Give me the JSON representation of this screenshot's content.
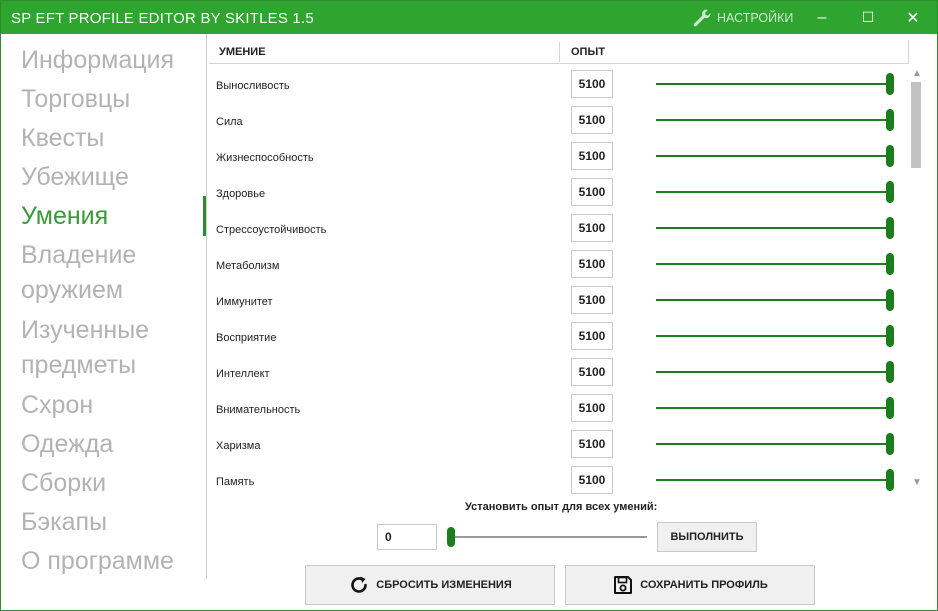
{
  "window": {
    "title": "SP EFT PROFILE EDITOR BY SKITLES 1.5",
    "settings_label": "НАСТРОЙКИ",
    "settings_icon": "wrench-icon",
    "minimize": "–",
    "maximize": "☐",
    "close": "✕"
  },
  "sidebar": {
    "items": [
      {
        "label": "Информация",
        "active": false
      },
      {
        "label": "Торговцы",
        "active": false
      },
      {
        "label": "Квесты",
        "active": false
      },
      {
        "label": "Убежище",
        "active": false
      },
      {
        "label": "Умения",
        "active": true
      },
      {
        "label": "Владение",
        "active": false
      },
      {
        "label": "оружием",
        "active": false
      },
      {
        "label": "Изученные",
        "active": false
      },
      {
        "label": "предметы",
        "active": false
      },
      {
        "label": "Схрон",
        "active": false
      },
      {
        "label": "Одежда",
        "active": false
      },
      {
        "label": "Сборки",
        "active": false
      },
      {
        "label": "Бэкапы",
        "active": false
      },
      {
        "label": "О программе",
        "active": false
      }
    ]
  },
  "table": {
    "columns": [
      "УМЕНИЕ",
      "ОПЫТ"
    ],
    "rows": [
      {
        "skill": "Выносливость",
        "xp": "5100",
        "level": 1.0
      },
      {
        "skill": "Сила",
        "xp": "5100",
        "level": 1.0
      },
      {
        "skill": "Жизнеспособность",
        "xp": "5100",
        "level": 1.0
      },
      {
        "skill": "Здоровье",
        "xp": "5100",
        "level": 1.0
      },
      {
        "skill": "Стрессоустойчивость",
        "xp": "5100",
        "level": 1.0
      },
      {
        "skill": "Метаболизм",
        "xp": "5100",
        "level": 1.0
      },
      {
        "skill": "Иммунитет",
        "xp": "5100",
        "level": 1.0
      },
      {
        "skill": "Восприятие",
        "xp": "5100",
        "level": 1.0
      },
      {
        "skill": "Интеллект",
        "xp": "5100",
        "level": 1.0
      },
      {
        "skill": "Внимательность",
        "xp": "5100",
        "level": 1.0
      },
      {
        "skill": "Харизма",
        "xp": "5100",
        "level": 1.0
      },
      {
        "skill": "Память",
        "xp": "5100",
        "level": 1.0
      }
    ]
  },
  "set_all": {
    "label": "Установить опыт для всех умений:",
    "value": "0",
    "level": 0.0,
    "execute_label": "ВЫПОЛНИТЬ"
  },
  "actions": {
    "reset_label": "СБРОСИТЬ ИЗМЕНЕНИЯ",
    "reset_icon": "reset-icon",
    "save_label": "СОХРАНИТЬ ПРОФИЛЬ",
    "save_icon": "save-icon"
  },
  "colors": {
    "accent": "#2ea52e",
    "slider": "#1d7d1d",
    "nav_active": "#3a9a3a",
    "nav_inactive": "#b3b3b3"
  }
}
